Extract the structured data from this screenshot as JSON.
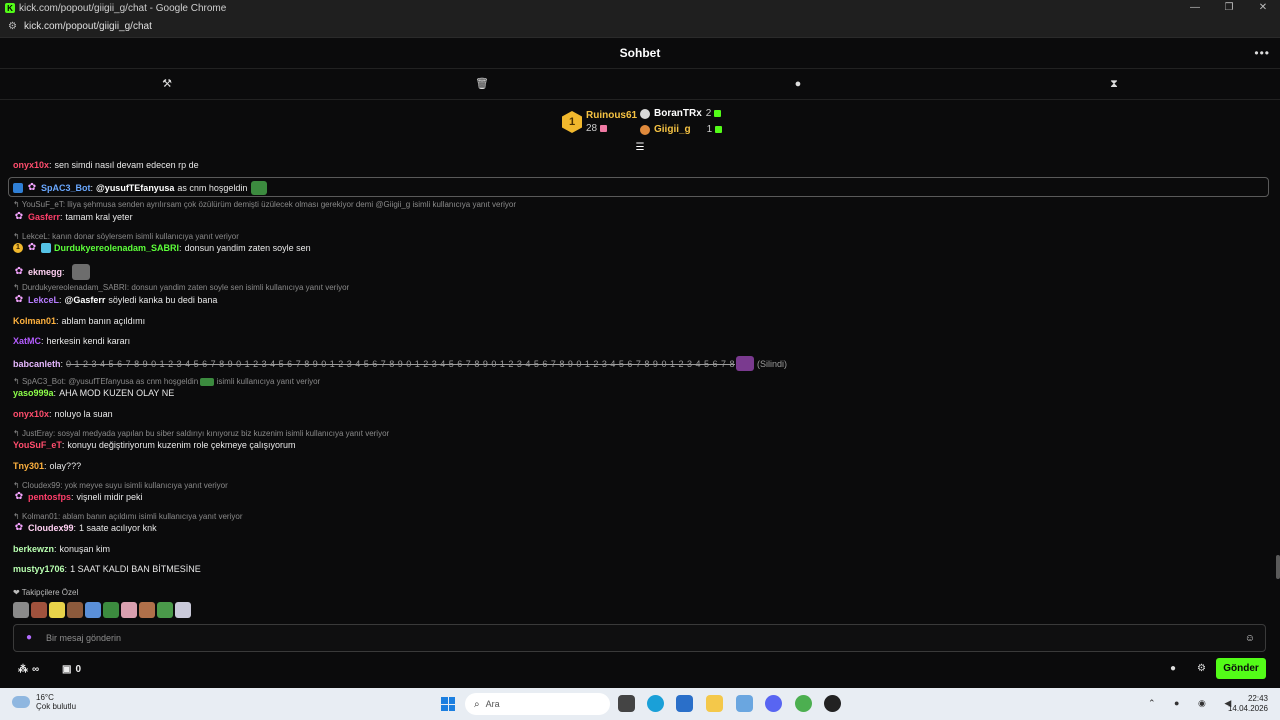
{
  "window": {
    "title": "kick.com/popout/giigii_g/chat - Google Chrome",
    "url": "kick.com/popout/giigii_g/chat"
  },
  "chat": {
    "title": "Sohbet"
  },
  "leaderboard": {
    "first": {
      "rank": "1",
      "name": "Ruinous61",
      "count": "28"
    },
    "others": [
      {
        "name": "BoranTRx",
        "count": "2"
      },
      {
        "name": "Giigii_g",
        "count": "1"
      }
    ]
  },
  "messages": [
    {
      "user": "onyx10x",
      "color": "#ff4d6d",
      "text": "sen simdi nasıl devam edecen rp de"
    },
    {
      "user": "SpAC3_Bot",
      "color": "#6aa8ff",
      "mention": "@yusufTEfanyusa",
      "text": "as cnm hoşgeldin"
    },
    {
      "reply": "YouSuF_eT: lliya şehmusa senden ayrılırsam çok özülürüm demişti üzülecek olması gerekiyor demi @Giigii_g isimli kullanıcıya yanıt veriyor"
    },
    {
      "user": "Gasferr",
      "color": "#ff3f6b",
      "text": "tamam kral yeter"
    },
    {
      "reply": "LekceL: kanın donar söylersem isimli kullanıcıya yanıt veriyor"
    },
    {
      "user": "Durdukyereolenadam_SABRI",
      "color": "#5dff3a",
      "text": "donsun yandim zaten soyle sen"
    },
    {
      "user": "ekmegg",
      "color": "#ffd0f2",
      "text": ""
    },
    {
      "reply": "Durdukyereolenadam_SABRI: donsun yandim zaten soyle sen isimli kullanıcıya yanıt veriyor"
    },
    {
      "user": "LekceL",
      "color": "#b77cff",
      "mention": "@Gasferr",
      "text": "söyledi kanka bu dedi bana"
    },
    {
      "user": "Kolman01",
      "color": "#ffb23f",
      "text": "ablam banın açıldımı"
    },
    {
      "user": "XatMC",
      "color": "#b45cff",
      "text": "herkesin kendi kararı"
    },
    {
      "user": "babcanleth",
      "color": "#e6b8ff",
      "text": "0 1 2 3 4 5 6 7 8 9 0 1 2 3 4 5 6 7 8 9 0 1 2 3 4 5 6 7 8 9 0 1 2 3 4 5 6 7 8 9 0 1 2 3 4 5 6 7 8 9 0 1 2 3 4 5 6 7 8 9 0 1 2 3 4 5 6 7 8 9 0 1 2 3 4 5 6 7 8",
      "deleted_tag": "(Silindi)"
    },
    {
      "reply": "SpAC3_Bot: @yusufTEfanyusa as cnm hoşgeldin",
      "reply_tail": "isimli kullanıcıya yanıt veriyor"
    },
    {
      "user": "yaso999a",
      "color": "#8dff4a",
      "text": "AHA MOD KUZEN OLAY NE"
    },
    {
      "user": "onyx10x",
      "color": "#ff4d6d",
      "text": "noluyo la suan"
    },
    {
      "reply": "JustEray: sosyal medyada yapılan bu siber saldırıyı kınıyoruz biz kuzenim isimli kullanıcıya yanıt veriyor"
    },
    {
      "user": "YouSuF_eT",
      "color": "#ff4d6d",
      "text": "konuyu değiştiriyorum kuzenim role çekmeye çalışıyorum"
    },
    {
      "user": "Tny301",
      "color": "#ffb23f",
      "text": "olay???"
    },
    {
      "reply": "Cloudex99: yok meyve suyu isimli kullanıcıya yanıt veriyor"
    },
    {
      "user": "pentosfps",
      "color": "#ff3f6b",
      "text": "vişneli midir peki"
    },
    {
      "reply": "Kolman01: ablam banın açıldımı isimli kullanıcıya yanıt veriyor"
    },
    {
      "user": "Cloudex99",
      "color": "#ffd0f2",
      "text": "1 saate acılıyor knk"
    },
    {
      "user": "berkewzn",
      "color": "#b8ffb0",
      "text": "konuşan kim"
    },
    {
      "user": "mustyy1706",
      "color": "#b8ffb0",
      "text": "1 SAAT KALDI BAN BİTMESİNE"
    }
  ],
  "emotes": {
    "label": "Takipçilere Özel"
  },
  "input": {
    "placeholder": "Bir mesaj gönderin"
  },
  "footer": {
    "infinity": "∞",
    "count": "0",
    "send_label": "Gönder"
  },
  "taskbar": {
    "temp": "16°C",
    "weather": "Çok bulutlu",
    "search_placeholder": "Ara",
    "time": "22:43",
    "date": "14.04.2026"
  },
  "colors": {
    "accent": "#53fc18",
    "background": "#0b0b0c"
  }
}
